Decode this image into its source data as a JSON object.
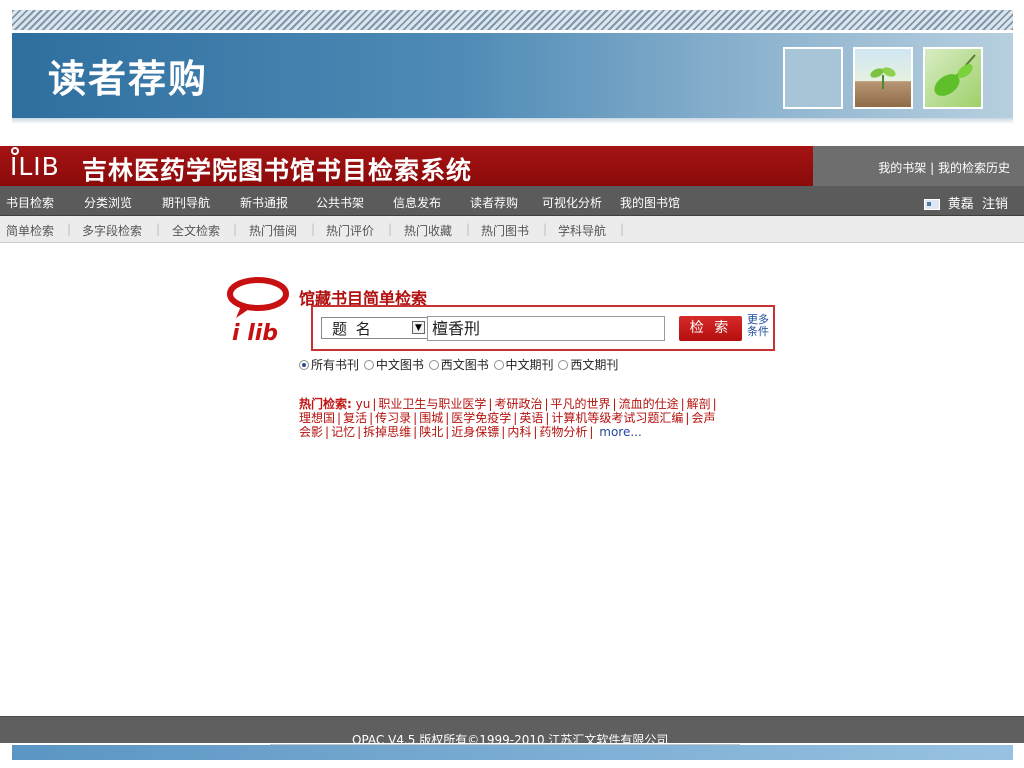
{
  "slide": {
    "title": "读者荐购"
  },
  "banner": {
    "logo_text": "ILIB",
    "site_title": "吉林医药学院图书馆书目检索系统",
    "top_links": [
      "我的书架",
      "我的检索历史"
    ],
    "top_links_sep": "|"
  },
  "mainnav": {
    "items": [
      "书目检索",
      "分类浏览",
      "期刊导航",
      "新书通报",
      "公共书架",
      "信息发布",
      "读者荐购",
      "可视化分析",
      "我的图书馆"
    ],
    "user_name": "黄磊",
    "logout": "注销"
  },
  "subnav": {
    "items": [
      "简单检索",
      "多字段检索",
      "全文检索",
      "热门借阅",
      "热门评价",
      "热门收藏",
      "热门图书",
      "学科导航"
    ]
  },
  "search": {
    "logo_text": "i lib",
    "heading": "馆藏书目简单检索",
    "field_selected": "题 名",
    "query": "檀香刑",
    "button": "检 索",
    "more_line1": "更多",
    "more_line2": "条件",
    "options": [
      "所有书刊",
      "中文图书",
      "西文图书",
      "中文期刊",
      "西文期刊"
    ],
    "selected_option": 0
  },
  "hot": {
    "label": "热门检索:",
    "keywords": [
      "yu",
      "职业卫生与职业医学",
      "考研政治",
      "平凡的世界",
      "流血的仕途",
      "解剖",
      "理想国",
      "复活",
      "传习录",
      "围城",
      "医学免疫学",
      "英语",
      "计算机等级考试习题汇编",
      "会声会影",
      "记忆",
      "拆掉思维",
      "陕北",
      "近身保镖",
      "内科",
      "药物分析"
    ],
    "more": "more..."
  },
  "footer": {
    "text": "OPAC V4.5    版权所有©1999-2010 江苏汇文软件有限公司"
  },
  "colors": {
    "banner_red": "#a51313",
    "accent_blue": "#2e6f9f",
    "hot_red": "#b5120f"
  }
}
